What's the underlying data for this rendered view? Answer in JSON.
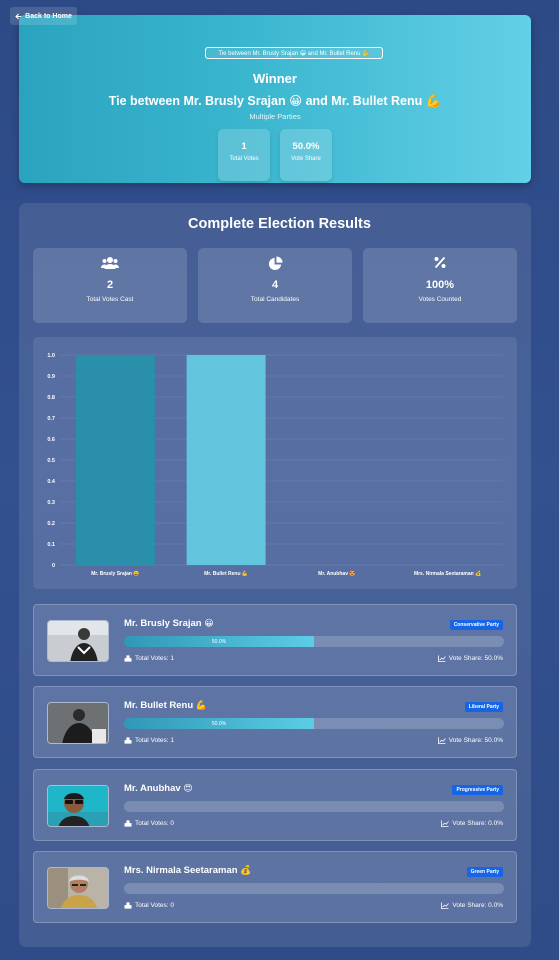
{
  "nav": {
    "back_label": "Back to Home",
    "back_icon": "arrow-left-icon"
  },
  "winner": {
    "image_alt": "Tie between Mr. Brusly Srajan 😀 and Mr. Bullet Renu 💪",
    "label": "Winner",
    "name": "Tie between Mr. Brusly Srajan 😀 and Mr. Bullet Renu 💪",
    "party": "Multiple Parties",
    "stats": [
      {
        "value": "1",
        "label": "Total Votes"
      },
      {
        "value": "50.0%",
        "label": "Vote Share"
      }
    ]
  },
  "results": {
    "title": "Complete Election Results",
    "stats": [
      {
        "icon": "users-icon",
        "value": "2",
        "label": "Total Votes Cast"
      },
      {
        "icon": "pie-chart-icon",
        "value": "4",
        "label": "Total Candidates"
      },
      {
        "icon": "percent-icon",
        "value": "100%",
        "label": "Votes Counted"
      }
    ]
  },
  "chart_data": {
    "type": "bar",
    "title": "",
    "xlabel": "",
    "ylabel": "",
    "categories": [
      "Mr. Brusly Srajan 😀",
      "Mr. Bullet Renu 💪",
      "Mr. Anubhav 😍",
      "Mrs. Nirmala Seetaraman 💰"
    ],
    "values": [
      1,
      1,
      0,
      0
    ],
    "ylim": [
      0,
      1.0
    ],
    "yticks": [
      "0",
      "0.1",
      "0.2",
      "0.3",
      "0.4",
      "0.5",
      "0.6",
      "0.7",
      "0.8",
      "0.9",
      "1.0"
    ],
    "bar_colors": [
      "#2a8fab",
      "#62c4dd",
      "#2a8fab",
      "#62c4dd"
    ],
    "grid": true,
    "legend": "none"
  },
  "candidates": [
    {
      "name": "Mr. Brusly Srajan",
      "emoji": "😀",
      "party": "Conservative Party",
      "share": 0.5,
      "bar_label": "50.0%",
      "votes_label": "Total Votes: 1",
      "share_label": "Vote Share: 50.0%"
    },
    {
      "name": "Mr. Bullet Renu",
      "emoji": "💪",
      "party": "Liberal Party",
      "share": 0.5,
      "bar_label": "50.0%",
      "votes_label": "Total Votes: 1",
      "share_label": "Vote Share: 50.0%"
    },
    {
      "name": "Mr. Anubhav",
      "emoji": "😍",
      "party": "Progressive Party",
      "share": 0,
      "bar_label": "",
      "votes_label": "Total Votes: 0",
      "share_label": "Vote Share: 0.0%"
    },
    {
      "name": "Mrs. Nirmala Seetaraman",
      "emoji": "💰",
      "party": "Green Party",
      "share": 0,
      "bar_label": "",
      "votes_label": "Total Votes: 0",
      "share_label": "Vote Share: 0.0%"
    }
  ]
}
